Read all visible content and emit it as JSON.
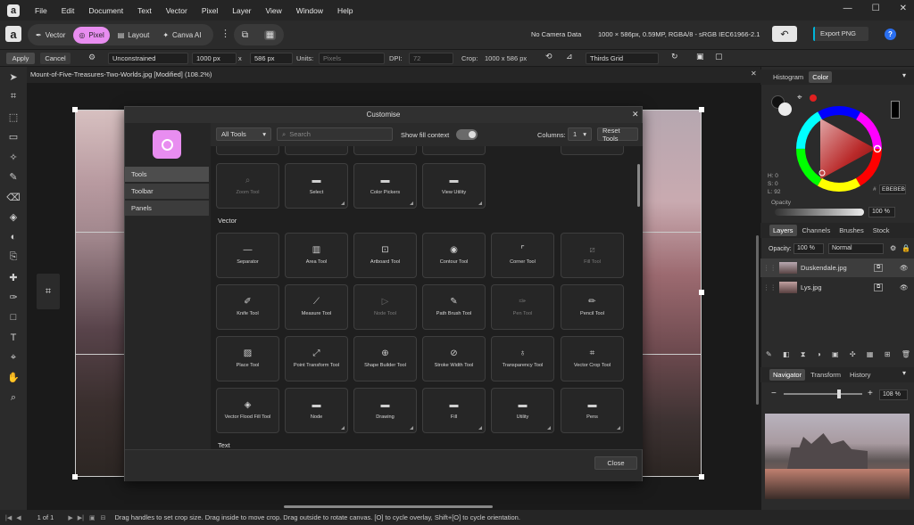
{
  "menu": [
    "File",
    "Edit",
    "Document",
    "Text",
    "Vector",
    "Pixel",
    "Layer",
    "View",
    "Window",
    "Help"
  ],
  "app_logo": "a",
  "personas": [
    {
      "label": "Vector"
    },
    {
      "label": "Pixel"
    },
    {
      "label": "Layout"
    },
    {
      "label": "Canva AI"
    }
  ],
  "camera": "No Camera Data",
  "docinfo": "1000 × 586px, 0.59MP, RGBA/8 - sRGB IEC61966-2.1",
  "export_label": "Export PNG",
  "context": {
    "apply": "Apply",
    "cancel": "Cancel",
    "mode": "Unconstrained",
    "width": "1000 px",
    "x": "x",
    "height": "586 px",
    "units_label": "Units:",
    "units": "Pixels",
    "dpi_label": "DPI:",
    "dpi": "72",
    "crop_label": "Crop:",
    "crop": "1000 x 586 px",
    "overlay": "Thirds Grid"
  },
  "doc_tab": "Mount-of-Five-Treasures-Two-Worlds.jpg [Modified] (108.2%)",
  "dialog": {
    "title": "Customise",
    "sidebar": [
      "Tools",
      "Toolbar",
      "Panels"
    ],
    "filter": "All Tools",
    "search_placeholder": "Search",
    "show_fill": "Show fill context",
    "columns_label": "Columns:",
    "columns": "1",
    "reset": "Reset Tools",
    "row0": [
      {
        "label": "Zoom Tool",
        "dim": true
      },
      {
        "label": "Select"
      },
      {
        "label": "Color Pickers"
      },
      {
        "label": "View Utility"
      }
    ],
    "section_vector": "Vector",
    "row1": [
      {
        "label": "Separator"
      },
      {
        "label": "Area Tool"
      },
      {
        "label": "Artboard Tool"
      },
      {
        "label": "Contour Tool"
      },
      {
        "label": "Corner Tool"
      },
      {
        "label": "Fill Tool",
        "dim": true
      }
    ],
    "row2": [
      {
        "label": "Knife Tool"
      },
      {
        "label": "Measure Tool"
      },
      {
        "label": "Node Tool",
        "dim": true
      },
      {
        "label": "Path Brush Tool"
      },
      {
        "label": "Pen Tool",
        "dim": true
      },
      {
        "label": "Pencil Tool"
      }
    ],
    "row3": [
      {
        "label": "Place Tool"
      },
      {
        "label": "Point Transform Tool"
      },
      {
        "label": "Shape Builder Tool"
      },
      {
        "label": "Stroke Width Tool"
      },
      {
        "label": "Transparency Tool"
      },
      {
        "label": "Vector Crop Tool"
      }
    ],
    "row4": [
      {
        "label": "Vector Flood Fill Tool"
      },
      {
        "label": "Node"
      },
      {
        "label": "Drawing"
      },
      {
        "label": "Fill"
      },
      {
        "label": "Utility"
      },
      {
        "label": "Pens"
      }
    ],
    "section_text": "Text",
    "close": "Close"
  },
  "color_panel": {
    "tabs": [
      "Histogram",
      "Color"
    ],
    "h": "H: 0",
    "s": "S: 0",
    "l": "L: 92",
    "hex_label": "#",
    "hex": "EBEBEB",
    "opacity_label": "Opacity",
    "opacity": "100 %"
  },
  "layers_panel": {
    "tabs": [
      "Layers",
      "Channels",
      "Brushes",
      "Stock"
    ],
    "opacity_label": "Opacity:",
    "opacity": "100 %",
    "blend": "Normal",
    "layers": [
      {
        "name": "Duskendale.jpg"
      },
      {
        "name": "Lys.jpg"
      }
    ]
  },
  "navigator": {
    "tabs": [
      "Navigator",
      "Transform",
      "History"
    ],
    "zoom": "108 %"
  },
  "status": {
    "page": "1 of 1",
    "hint": "Drag handles to set crop size. Drag inside to move crop. Drag outside to rotate canvas. [O] to cycle overlay, Shift+[O] to cycle orientation."
  },
  "colors": {
    "accent": "#e88df0",
    "cyan": "#00b4d8"
  }
}
